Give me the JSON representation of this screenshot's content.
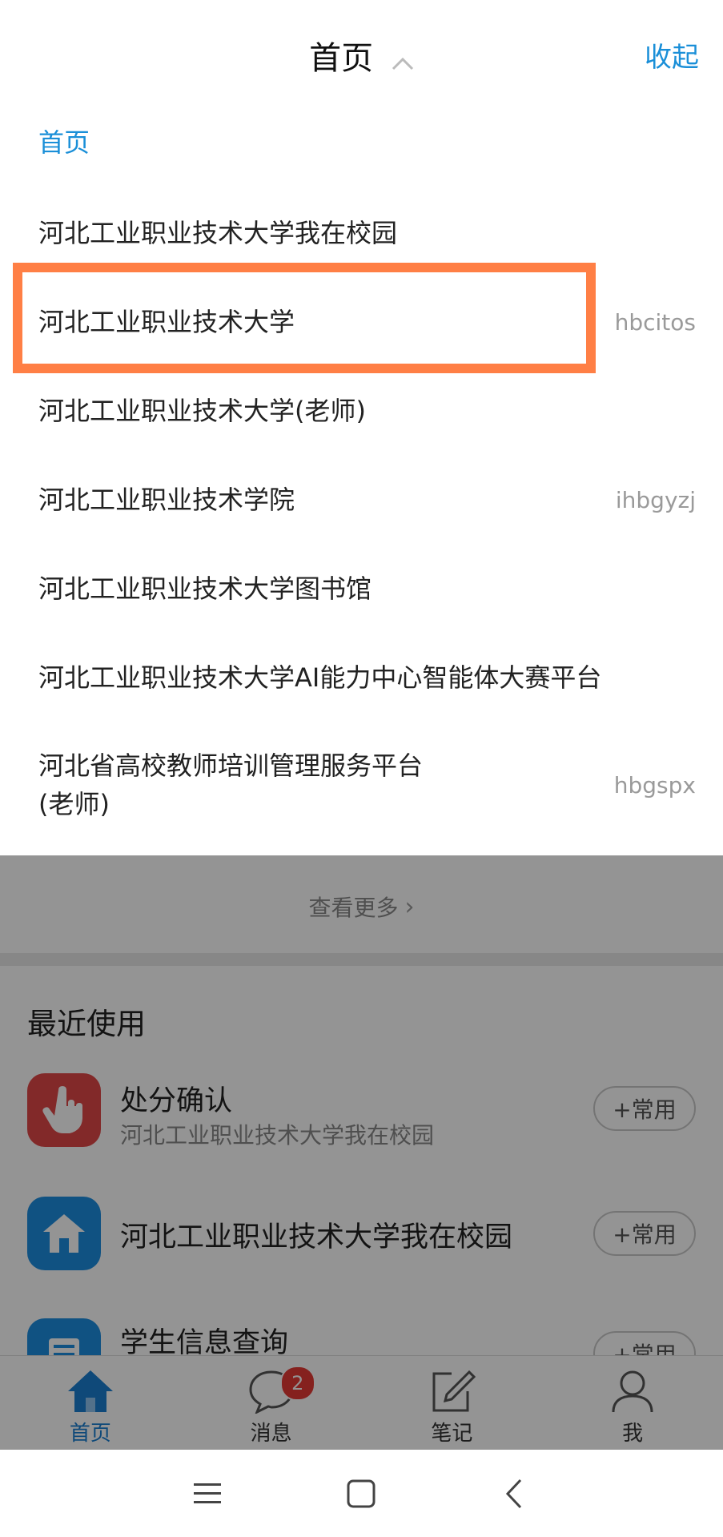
{
  "header": {
    "title": "首页",
    "collapse_label": "收起"
  },
  "schools": [
    {
      "name": "首页",
      "code": "",
      "current": true
    },
    {
      "name": "河北工业职业技术大学我在校园",
      "code": ""
    },
    {
      "name": "河北工业职业技术大学",
      "code": "hbcitos",
      "highlighted": true
    },
    {
      "name": "河北工业职业技术大学(老师)",
      "code": ""
    },
    {
      "name": "河北工业职业技术学院",
      "code": "ihbgyzj"
    },
    {
      "name": "河北工业职业技术大学图书馆",
      "code": ""
    },
    {
      "name": "河北工业职业技术大学AI能力中心智能体大赛平台",
      "code": ""
    },
    {
      "name_line1": "河北省高校教师培训管理服务平台",
      "name_line2": "(老师)",
      "code": "hbgspx"
    }
  ],
  "more": {
    "label": "查看更多"
  },
  "recent": {
    "title": "最近使用",
    "items": [
      {
        "name": "处分确认",
        "sub": "河北工业职业技术大学我在校园",
        "fav_label": "+常用",
        "icon": "hand-pointer-icon",
        "color": "#e04848"
      },
      {
        "name": "河北工业职业技术大学我在校园",
        "sub": "",
        "fav_label": "+常用",
        "icon": "home-icon",
        "color": "#1d8de0"
      },
      {
        "name": "学生信息查询",
        "sub": "",
        "fav_label": "+常用",
        "icon": "document-icon",
        "color": "#1d8de0"
      }
    ]
  },
  "tabbar": {
    "items": [
      {
        "label": "首页",
        "icon": "home-icon",
        "active": true
      },
      {
        "label": "消息",
        "icon": "chat-bubble-icon",
        "badge": "2"
      },
      {
        "label": "笔记",
        "icon": "note-edit-icon"
      },
      {
        "label": "我",
        "icon": "person-icon"
      }
    ]
  },
  "colors": {
    "accent": "#1a8fd8",
    "highlight": "#ff7f45",
    "badge": "#e53935"
  }
}
